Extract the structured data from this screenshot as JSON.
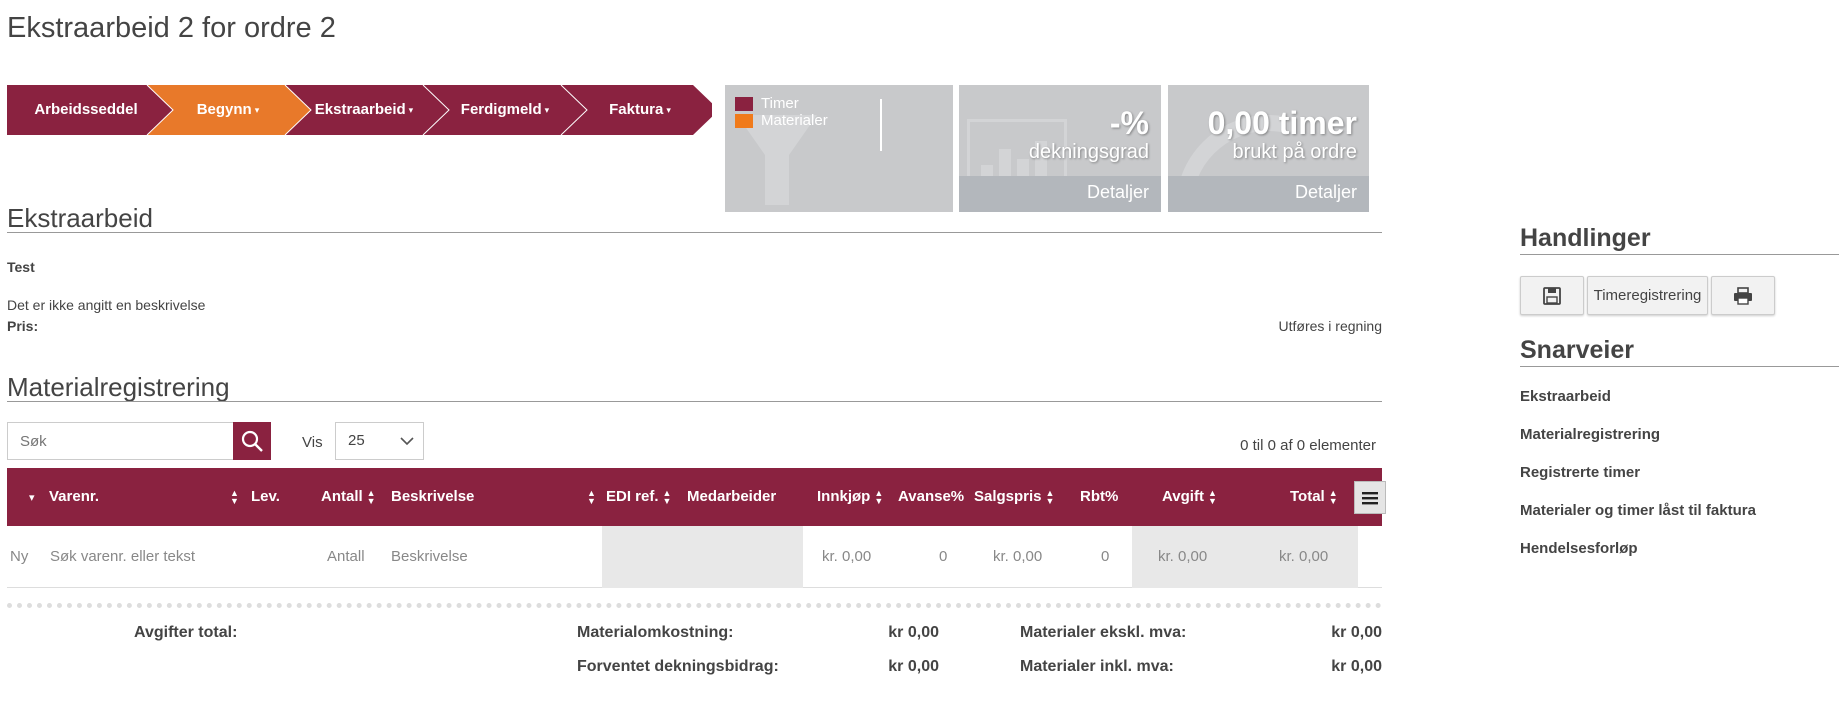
{
  "page": {
    "title": "Ekstraarbeid 2 for ordre 2"
  },
  "workflow": {
    "steps": [
      {
        "label": "Arbeidsseddel",
        "dropdown": false,
        "active": false
      },
      {
        "label": "Begynn",
        "dropdown": true,
        "active": true
      },
      {
        "label": "Ekstraarbeid",
        "dropdown": true,
        "active": false
      },
      {
        "label": "Ferdigmeld",
        "dropdown": true,
        "active": false
      },
      {
        "label": "Faktura",
        "dropdown": true,
        "active": false
      }
    ],
    "caret": "▾",
    "colors": {
      "primary": "#8a2240",
      "active": "#e8792a"
    }
  },
  "kpi": {
    "legend": [
      {
        "label": "Timer",
        "color": "#8a2240"
      },
      {
        "label": "Materialer",
        "color": "#f07a1a"
      }
    ],
    "coverage": {
      "value": "-%",
      "label": "dekningsgrad",
      "link": "Detaljer"
    },
    "hours": {
      "value": "0,00 timer",
      "label": "brukt på ordre",
      "link": "Detaljer"
    }
  },
  "ekstraarbeid": {
    "heading": "Ekstraarbeid",
    "name": "Test",
    "description": "Det er ikke angitt en beskrivelse",
    "price_label": "Pris:",
    "price_value": "Utføres i regning"
  },
  "materials": {
    "heading": "Materialregistrering",
    "search_placeholder": "Søk",
    "show_label": "Vis",
    "page_size": "25",
    "count_text": "0 til 0 af 0 elementer",
    "columns": [
      "Varenr.",
      "Lev.",
      "Antall",
      "Beskrivelse",
      "EDI ref.",
      "Medarbeider",
      "Innkjøp",
      "Avanse%",
      "Salgspris",
      "Rbt%",
      "Avgift",
      "Total"
    ],
    "new_row": {
      "prefix": "Ny",
      "varenr_placeholder": "Søk varenr. eller tekst",
      "antall_placeholder": "Antall",
      "beskrivelse_placeholder": "Beskrivelse",
      "innkjop": "kr. 0,00",
      "avanse": "0",
      "salgspris": "kr. 0,00",
      "rabatt": "0",
      "avgift": "kr. 0,00",
      "total": "kr. 0,00"
    }
  },
  "summary": {
    "fees_label": "Avgifter total:",
    "material_cost_label": "Materialomkostning:",
    "material_cost_value": "kr 0,00",
    "expected_margin_label": "Forventet dekningsbidrag:",
    "expected_margin_value": "kr 0,00",
    "excl_vat_label": "Materialer ekskl. mva:",
    "excl_vat_value": "kr 0,00",
    "incl_vat_label": "Materialer inkl. mva:",
    "incl_vat_value": "kr 0,00"
  },
  "sidebar": {
    "actions_heading": "Handlinger",
    "time_registration_label": "Timeregistrering",
    "shortcuts_heading": "Snarveier",
    "shortcuts": [
      "Ekstraarbeid",
      "Materialregistrering",
      "Registrerte timer",
      "Materialer og timer låst til faktura",
      "Hendelsesforløp"
    ]
  }
}
